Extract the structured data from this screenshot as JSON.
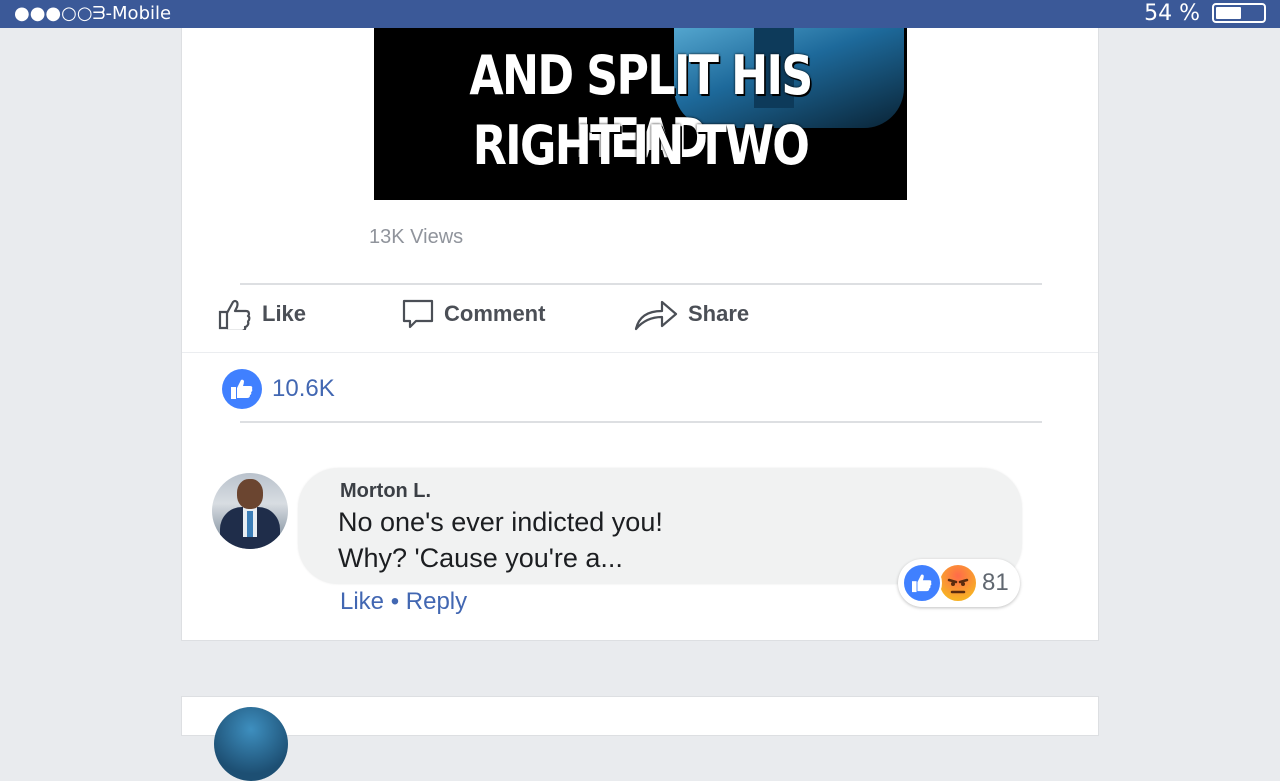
{
  "status_bar": {
    "carrier": "●●●○○ᗱ-Mobile",
    "battery_percent": "54 %",
    "battery_level": 0.54,
    "color": "#3b5998"
  },
  "post": {
    "meme_lines": [
      "AND SPLIT HIS HEAD",
      "RIGHT IN TWO"
    ],
    "views": "13K Views",
    "actions": {
      "like": "Like",
      "comment": "Comment",
      "share": "Share"
    },
    "reaction_total": "10.6K"
  },
  "comment": {
    "author": "Morton L.",
    "text_line1": "No one's ever indicted you!",
    "text_line2": "Why? 'Cause you're a...",
    "links": "Like • Reply",
    "reaction_count": "81",
    "reactions": [
      "like-icon",
      "angry-icon"
    ]
  },
  "colors": {
    "brand": "#3b5998",
    "link": "#4267b2",
    "like_blue": "#4080ff",
    "background": "#e9ebee"
  }
}
